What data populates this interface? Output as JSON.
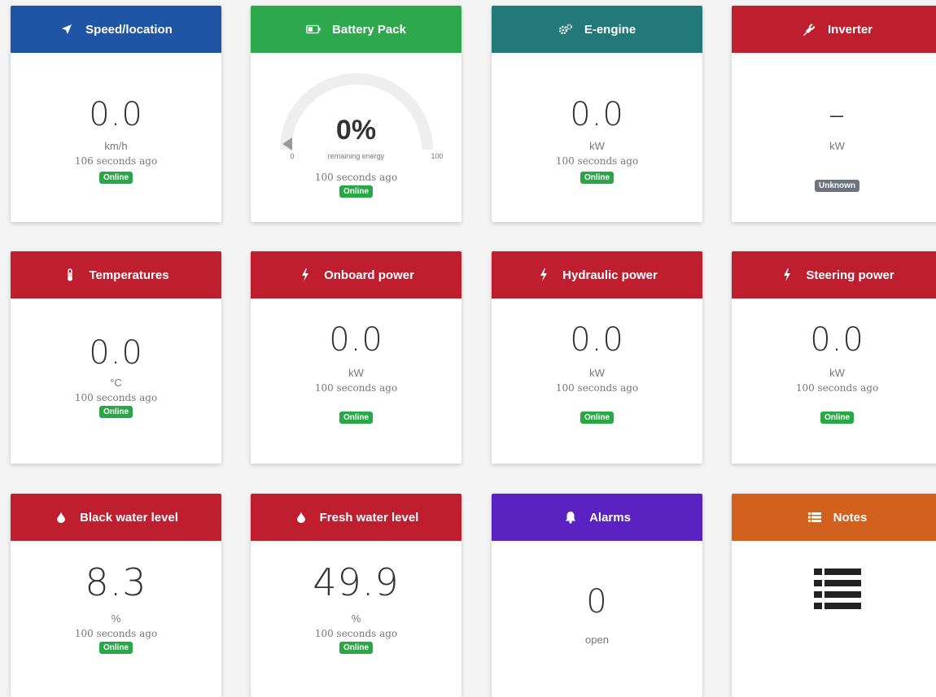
{
  "colors": {
    "blue": "#1f55a4",
    "green": "#2ea84c",
    "teal": "#23797a",
    "red": "#bf1e2e",
    "purple": "#5b22c2",
    "orange": "#d3611e",
    "online": "#28a745",
    "unknown": "#6c757d"
  },
  "cards": {
    "speed": {
      "title": "Speed/location",
      "icon": "location-arrow-icon",
      "value": "0.0",
      "unit": "km/h",
      "ago": "106 seconds ago",
      "status": "Online"
    },
    "battery": {
      "title": "Battery Pack",
      "icon": "battery-icon",
      "value": "0%",
      "sub": "remaining energy",
      "min": "0",
      "max": "100",
      "level": 0,
      "ago": "100 seconds ago",
      "status": "Online"
    },
    "engine": {
      "title": "E-engine",
      "icon": "cogs-icon",
      "value": "0.0",
      "unit": "kW",
      "ago": "100 seconds ago",
      "status": "Online"
    },
    "inverter": {
      "title": "Inverter",
      "icon": "plug-icon",
      "value": "–",
      "unit": "kW",
      "status": "Unknown"
    },
    "temps": {
      "title": "Temperatures",
      "icon": "thermometer-icon",
      "value": "0.0",
      "unit": "°C",
      "ago": "100 seconds ago",
      "status": "Online"
    },
    "onboard": {
      "title": "Onboard power",
      "icon": "bolt-icon",
      "value": "0.0",
      "unit": "kW",
      "ago": "100 seconds ago",
      "status": "Online"
    },
    "hydraulic": {
      "title": "Hydraulic power",
      "icon": "bolt-icon",
      "value": "0.0",
      "unit": "kW",
      "ago": "100 seconds ago",
      "status": "Online"
    },
    "steering": {
      "title": "Steering power",
      "icon": "bolt-icon",
      "value": "0.0",
      "unit": "kW",
      "ago": "100 seconds ago",
      "status": "Online"
    },
    "black": {
      "title": "Black water level",
      "icon": "droplet-icon",
      "value": "8.3",
      "unit": "%",
      "ago": "100 seconds ago",
      "status": "Online"
    },
    "fresh": {
      "title": "Fresh water level",
      "icon": "droplet-icon",
      "value": "49.9",
      "unit": "%",
      "ago": "100 seconds ago",
      "status": "Online"
    },
    "alarms": {
      "title": "Alarms",
      "icon": "bell-icon",
      "value": "0",
      "unit": "open"
    },
    "notes": {
      "title": "Notes",
      "icon": "list-icon"
    }
  }
}
